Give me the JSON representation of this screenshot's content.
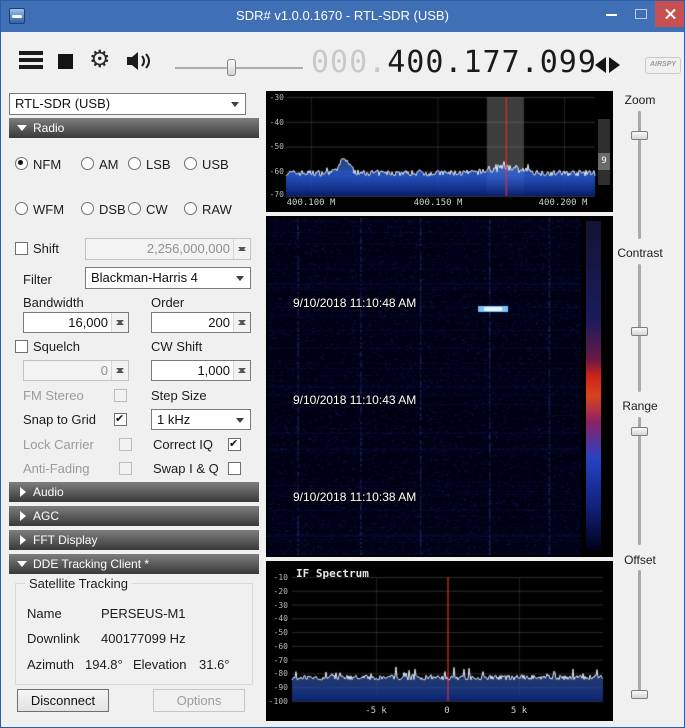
{
  "titlebar": {
    "title": "SDR# v1.0.0.1670 - RTL-SDR (USB)"
  },
  "toolbar": {
    "freq_prefix": "000.",
    "freq_main": "400.177.099",
    "logo": "AIRSPY"
  },
  "source_combo": {
    "value": "RTL-SDR (USB)"
  },
  "section_headers": {
    "radio": "Radio",
    "audio": "Audio",
    "agc": "AGC",
    "fft_display": "FFT Display",
    "dde": "DDE Tracking Client *"
  },
  "radio_panel": {
    "modes": [
      {
        "label": "NFM",
        "selected": true
      },
      {
        "label": "AM",
        "selected": false
      },
      {
        "label": "LSB",
        "selected": false
      },
      {
        "label": "USB",
        "selected": false
      },
      {
        "label": "WFM",
        "selected": false
      },
      {
        "label": "DSB",
        "selected": false
      },
      {
        "label": "CW",
        "selected": false
      },
      {
        "label": "RAW",
        "selected": false
      }
    ],
    "shift": {
      "label": "Shift",
      "checked": false,
      "value": "2,256,000,000"
    },
    "filter": {
      "label": "Filter",
      "value": "Blackman-Harris 4"
    },
    "bandwidth": {
      "label": "Bandwidth",
      "value": "16,000"
    },
    "order": {
      "label": "Order",
      "value": "200"
    },
    "squelch": {
      "label": "Squelch",
      "checked": false,
      "value": "0"
    },
    "cw_shift": {
      "label": "CW Shift",
      "value": "1,000"
    },
    "fm_stereo": {
      "label": "FM Stereo",
      "checked": false
    },
    "step_size": {
      "label": "Step Size",
      "value": "1 kHz"
    },
    "snap_to_grid": {
      "label": "Snap to Grid",
      "checked": true
    },
    "lock_carrier": {
      "label": "Lock Carrier",
      "checked": false
    },
    "correct_iq": {
      "label": "Correct IQ",
      "checked": true
    },
    "anti_fading": {
      "label": "Anti-Fading",
      "checked": false
    },
    "swap_iq": {
      "label": "Swap I & Q",
      "checked": false
    }
  },
  "dde_panel": {
    "group_title": "Satellite Tracking",
    "name_label": "Name",
    "name_value": "PERSEUS-M1",
    "downlink_label": "Downlink",
    "downlink_value": "400177099 Hz",
    "azimuth_label": "Azimuth",
    "azimuth_value": "194.8°",
    "elevation_label": "Elevation",
    "elevation_value": "31.6°",
    "disconnect_label": "Disconnect",
    "options_label": "Options"
  },
  "spectrum": {
    "y_ticks": [
      "-30",
      "-40",
      "-50",
      "-60",
      "-70"
    ],
    "x_ticks": [
      "400.100 M",
      "400.150 M",
      "400.200 M"
    ],
    "zoom_badge": "9"
  },
  "waterfall": {
    "timestamps": [
      "9/10/2018 11:10:48 AM",
      "9/10/2018 11:10:43 AM",
      "9/10/2018 11:10:38 AM"
    ]
  },
  "if_spectrum": {
    "title": "IF Spectrum",
    "y_ticks": [
      "-10",
      "-20",
      "-30",
      "-40",
      "-50",
      "-60",
      "-70",
      "-80",
      "-90",
      "-100"
    ],
    "x_ticks": [
      "-5 k",
      "0",
      "5 k"
    ]
  },
  "side_sliders": [
    {
      "label": "Zoom"
    },
    {
      "label": "Contrast"
    },
    {
      "label": "Range"
    },
    {
      "label": "Offset"
    }
  ],
  "chart_data": [
    {
      "type": "line",
      "title": "RF Spectrum",
      "x_ticks": [
        "400.100 M",
        "400.150 M",
        "400.200 M"
      ],
      "ylim": [
        -70,
        -30
      ],
      "noise_floor_db": -62,
      "tuned_frequency_mhz": 400.177099,
      "grid": true
    },
    {
      "type": "heatmap",
      "title": "Waterfall",
      "timestamps": [
        "9/10/2018 11:10:48 AM",
        "9/10/2018 11:10:43 AM",
        "9/10/2018 11:10:38 AM"
      ]
    },
    {
      "type": "line",
      "title": "IF Spectrum",
      "x_ticks": [
        "-5 k",
        "0",
        "5 k"
      ],
      "ylim": [
        -100,
        -10
      ],
      "noise_floor_db": -85,
      "center_marker_hz": 0,
      "grid": true
    }
  ]
}
